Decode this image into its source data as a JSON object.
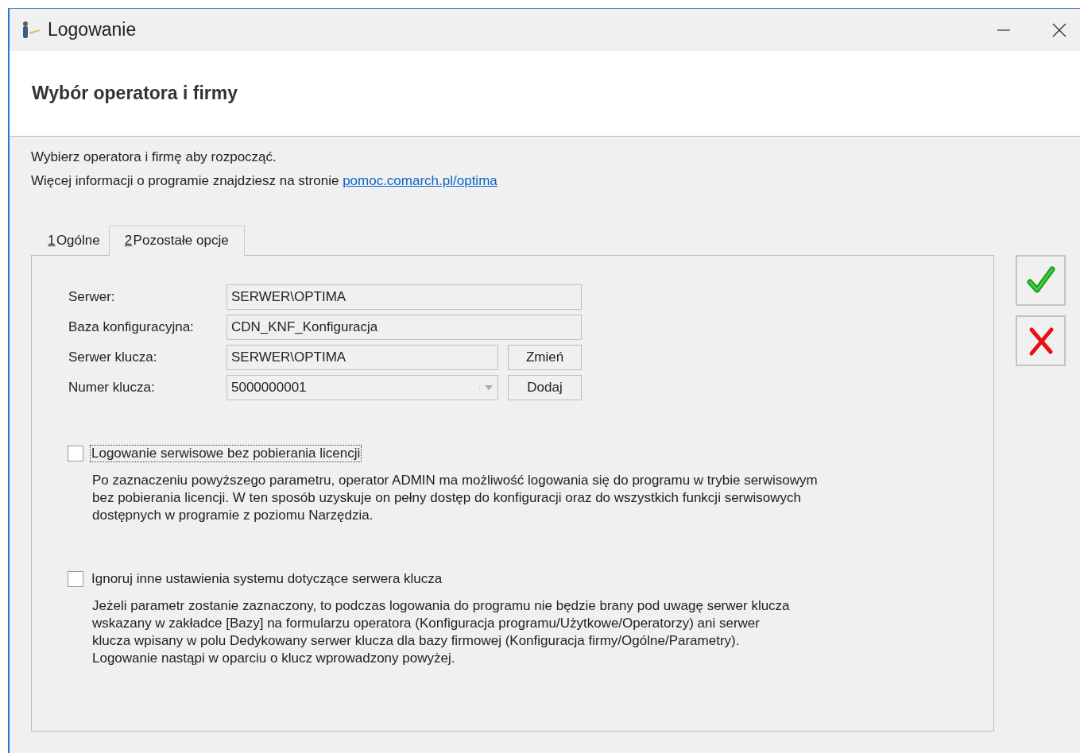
{
  "window": {
    "title": "Logowanie"
  },
  "header": {
    "title": "Wybór operatora i firmy"
  },
  "intro": {
    "line_1": "Wybierz operatora i firmę aby rozpocząć.",
    "line_2": "Więcej informacji o programie znajdziesz na stronie",
    "link": "pomoc.comarch.pl/optima"
  },
  "tabs": [
    {
      "accelerator": "1",
      "label": "Ogólne",
      "selected": false
    },
    {
      "accelerator": "2",
      "label": "Pozostałe opcje",
      "selected": true
    }
  ],
  "fields": [
    {
      "kind": "input",
      "label": "Serwer:",
      "value": "SERWER\\OPTIMA"
    },
    {
      "kind": "input",
      "label": "Baza konfiguracyjna:",
      "value": "CDN_KNF_Konfiguracja"
    },
    {
      "kind": "input",
      "label": "Serwer klucza:",
      "value": "SERWER\\OPTIMA",
      "button": "Zmień"
    },
    {
      "kind": "dropdown",
      "label": "Numer klucza:",
      "value": "5000000001",
      "button": "Dodaj"
    }
  ],
  "options": [
    {
      "label": "Logowanie serwisowe bez pobierania licencji",
      "checked": false,
      "focused": true,
      "description": [
        "Po zaznaczeniu powyższego parametru, operator ADMIN ma możliwość logowania się do programu w trybie serwisowym",
        "bez pobierania licencji. W ten sposób uzyskuje on pełny dostęp do konfiguracji oraz do wszystkich funkcji serwisowych",
        "dostępnych w programie z poziomu Narzędzia."
      ]
    },
    {
      "label": "Ignoruj inne ustawienia systemu dotyczące serwera klucza",
      "checked": false,
      "focused": false,
      "description": [
        "Jeżeli parametr zostanie zaznaczony, to podczas logowania do programu nie będzie brany pod uwagę serwer klucza",
        "wskazany w zakładce [Bazy] na formularzu operatora (Konfiguracja programu/Użytkowe/Operatorzy) ani serwer",
        "klucza wpisany w polu Dedykowany serwer klucza dla bazy firmowej (Konfiguracja firmy/Ogólne/Parametry).",
        "Logowanie nastąpi w oparciu o klucz wprowadzony powyżej."
      ]
    }
  ]
}
